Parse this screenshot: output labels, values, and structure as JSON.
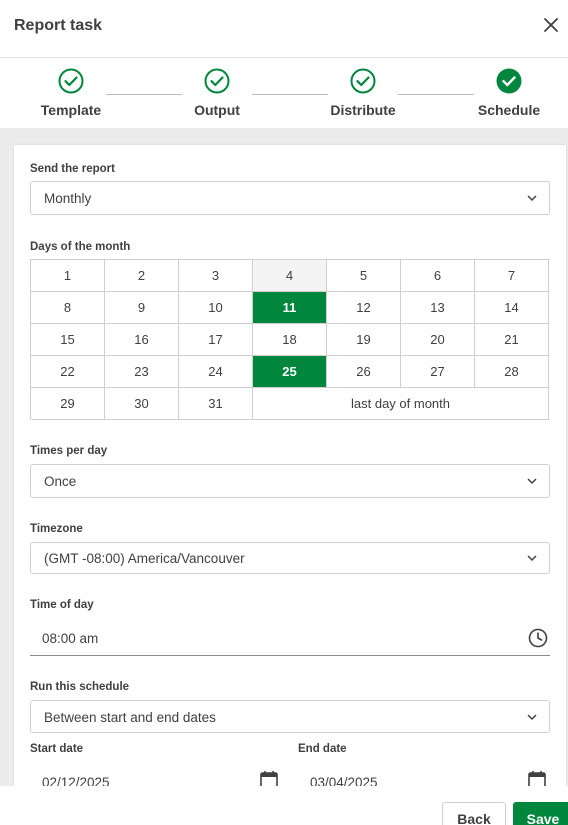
{
  "dialog": {
    "title": "Report task"
  },
  "steps": [
    {
      "label": "Template",
      "status": "done"
    },
    {
      "label": "Output",
      "status": "done"
    },
    {
      "label": "Distribute",
      "status": "done"
    },
    {
      "label": "Schedule",
      "status": "current"
    }
  ],
  "form": {
    "send_report": {
      "label": "Send the report",
      "value": "Monthly"
    },
    "days_of_month": {
      "label": "Days of the month",
      "days": [
        "1",
        "2",
        "3",
        "4",
        "5",
        "6",
        "7",
        "8",
        "9",
        "10",
        "11",
        "12",
        "13",
        "14",
        "15",
        "16",
        "17",
        "18",
        "19",
        "20",
        "21",
        "22",
        "23",
        "24",
        "25",
        "26",
        "27",
        "28",
        "29",
        "30",
        "31"
      ],
      "last_day_label": "last day of month",
      "selected": [
        "11",
        "25"
      ],
      "highlighted": "4"
    },
    "times_per_day": {
      "label": "Times per day",
      "value": "Once"
    },
    "timezone": {
      "label": "Timezone",
      "value": "(GMT -08:00) America/Vancouver"
    },
    "time_of_day": {
      "label": "Time of day",
      "value": "08:00 am"
    },
    "run_schedule": {
      "label": "Run this schedule",
      "value": "Between start and end dates"
    },
    "start_date": {
      "label": "Start date",
      "value": "02/12/2025"
    },
    "end_date": {
      "label": "End date",
      "value": "03/04/2025"
    }
  },
  "footer": {
    "back_label": "Back",
    "save_label": "Save"
  },
  "colors": {
    "accent": "#00873d",
    "text": "#404040",
    "border": "#cfcfcf",
    "background": "#ececec"
  },
  "icons": {
    "close": "close-icon",
    "step_done": "check-circle-icon",
    "dropdown": "chevron-down-icon",
    "clock": "clock-icon",
    "calendar": "calendar-icon"
  }
}
